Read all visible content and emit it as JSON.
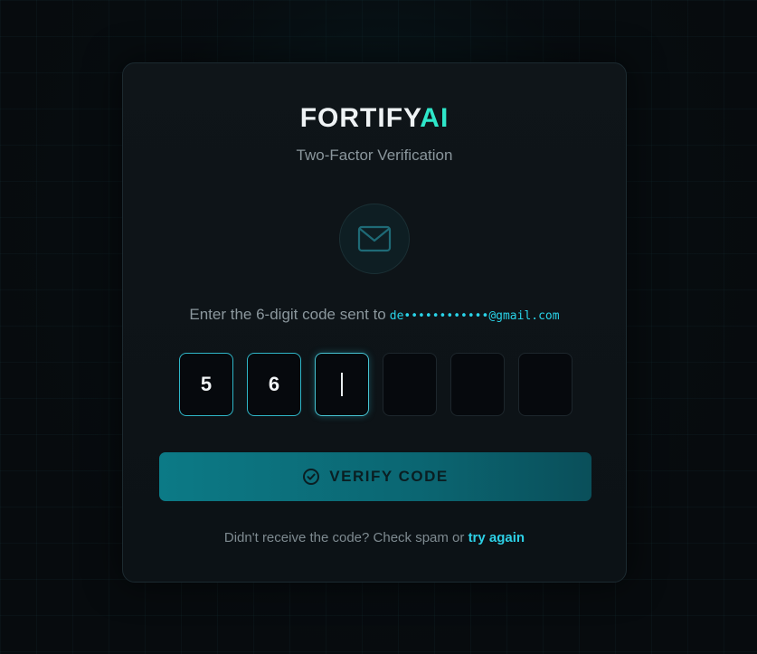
{
  "brand": {
    "name_main": "FORTIFY",
    "name_accent": "AI"
  },
  "subtitle": "Two-Factor Verification",
  "icon": {
    "name": "mail-icon",
    "color": "#1e6a76"
  },
  "instruction": {
    "text": "Enter the 6-digit code sent to",
    "email": "de••••••••••••@gmail.com"
  },
  "otp": {
    "digits": [
      "5",
      "6",
      "",
      "",
      "",
      ""
    ],
    "active_index": 2
  },
  "verify_button": {
    "label": "VERIFY CODE",
    "icon": "check-circle-icon"
  },
  "footer": {
    "text": "Didn't receive the code? Check spam or",
    "link_label": "try again"
  },
  "colors": {
    "accent": "#2ee6c9",
    "link": "#2dd0e6",
    "button": "#0c7a86"
  }
}
